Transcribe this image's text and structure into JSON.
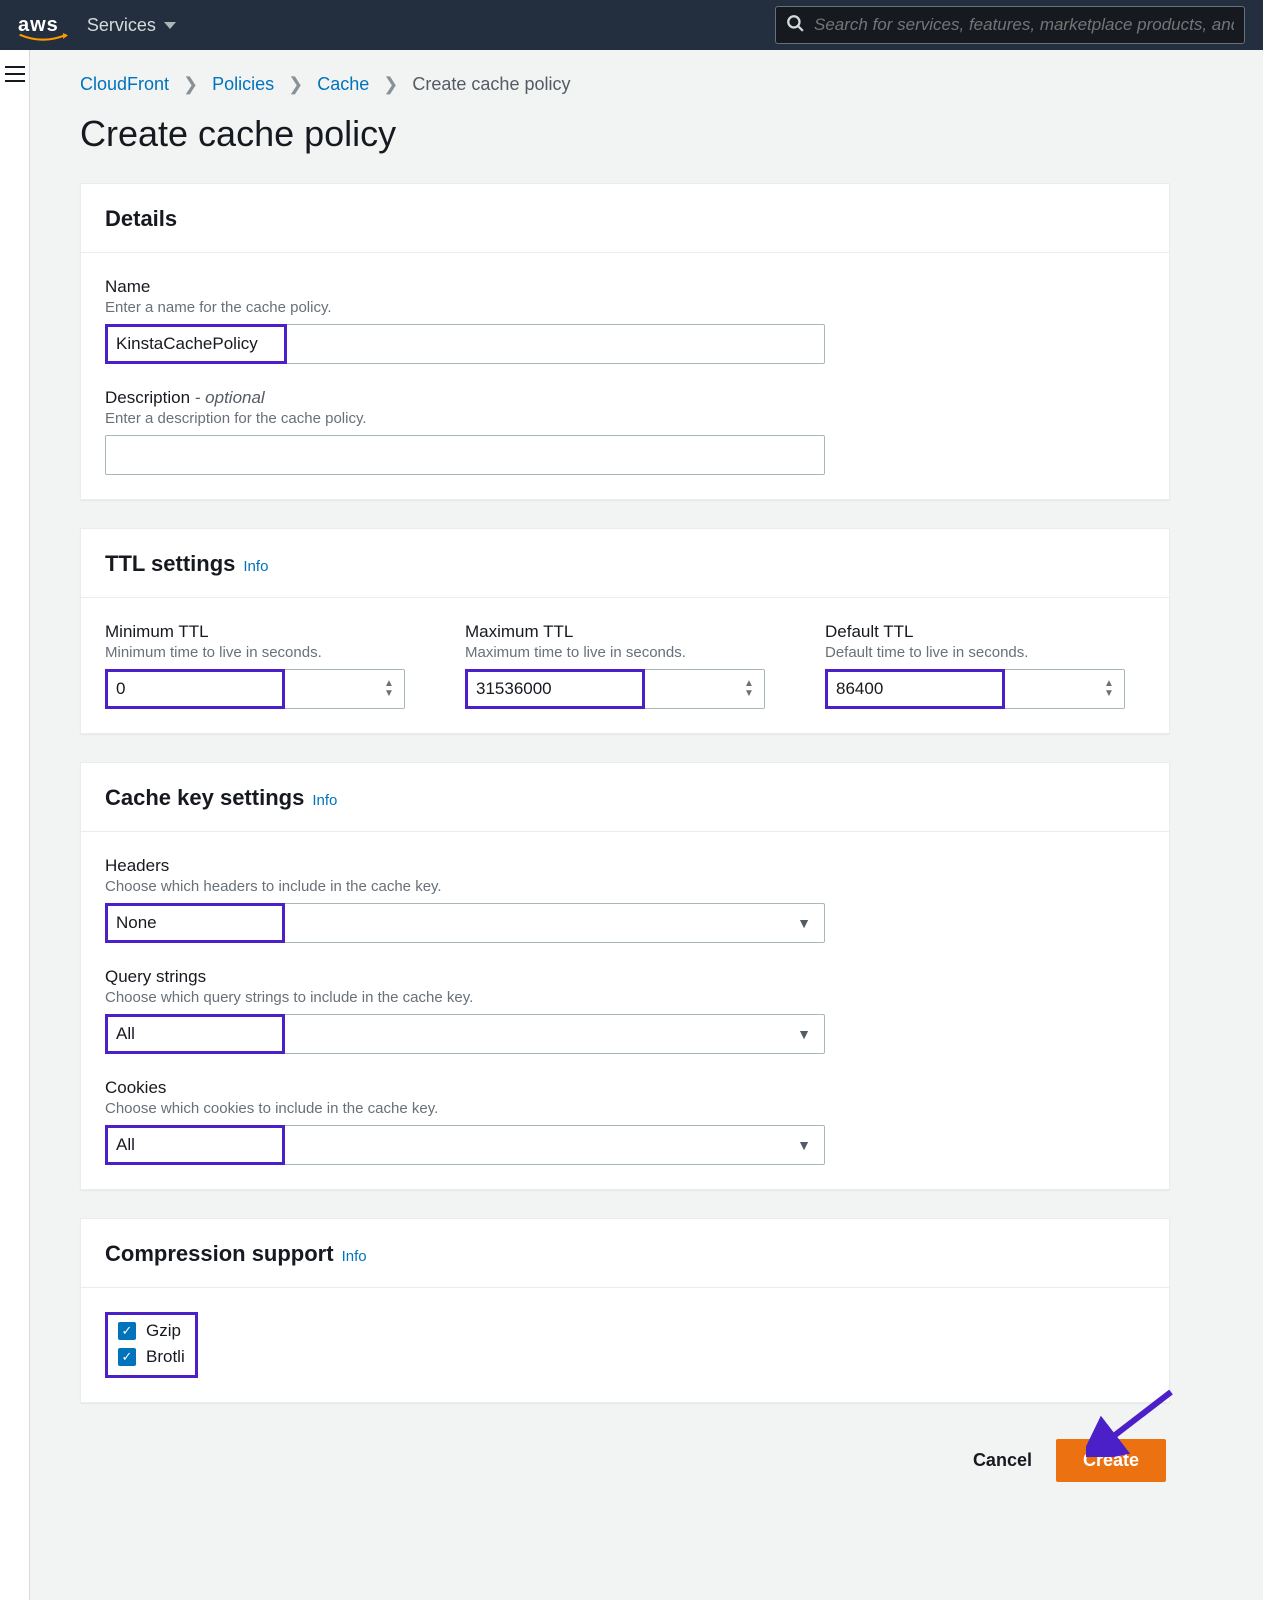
{
  "nav": {
    "services_label": "Services",
    "search_placeholder": "Search for services, features, marketplace products, and"
  },
  "breadcrumbs": {
    "items": [
      "CloudFront",
      "Policies",
      "Cache"
    ],
    "current": "Create cache policy"
  },
  "page_title": "Create cache policy",
  "details": {
    "title": "Details",
    "name_label": "Name",
    "name_hint": "Enter a name for the cache policy.",
    "name_value": "KinstaCachePolicy",
    "desc_label": "Description",
    "desc_opt": " - optional",
    "desc_hint": "Enter a description for the cache policy.",
    "desc_value": ""
  },
  "ttl": {
    "title": "TTL settings",
    "info": "Info",
    "min_label": "Minimum TTL",
    "min_hint": "Minimum time to live in seconds.",
    "min_value": "0",
    "max_label": "Maximum TTL",
    "max_hint": "Maximum time to live in seconds.",
    "max_value": "31536000",
    "def_label": "Default TTL",
    "def_hint": "Default time to live in seconds.",
    "def_value": "86400"
  },
  "cachekey": {
    "title": "Cache key settings",
    "info": "Info",
    "headers_label": "Headers",
    "headers_hint": "Choose which headers to include in the cache key.",
    "headers_value": "None",
    "qs_label": "Query strings",
    "qs_hint": "Choose which query strings to include in the cache key.",
    "qs_value": "All",
    "cookies_label": "Cookies",
    "cookies_hint": "Choose which cookies to include in the cache key.",
    "cookies_value": "All"
  },
  "compression": {
    "title": "Compression support",
    "info": "Info",
    "gzip_label": "Gzip",
    "brotli_label": "Brotli"
  },
  "actions": {
    "cancel": "Cancel",
    "create": "Create"
  }
}
